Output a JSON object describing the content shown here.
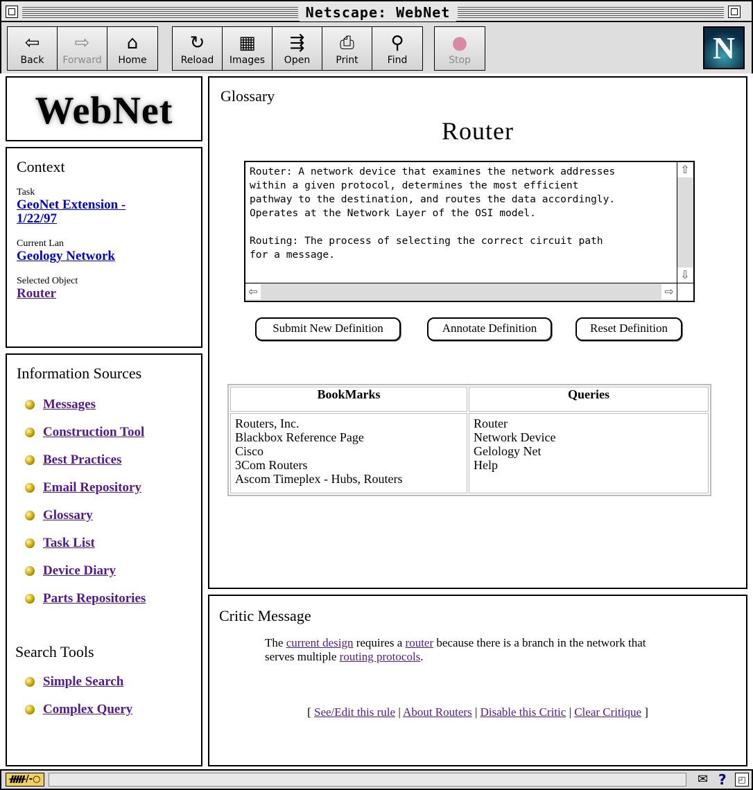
{
  "window": {
    "title": "Netscape: WebNet"
  },
  "toolbar": {
    "buttons": [
      {
        "label": "Back",
        "icon": "back-arrow-icon",
        "glyph": "⇦"
      },
      {
        "label": "Forward",
        "icon": "forward-arrow-icon",
        "glyph": "⇨"
      },
      {
        "label": "Home",
        "icon": "home-icon",
        "glyph": "⌂"
      },
      {
        "label": "Reload",
        "icon": "reload-icon",
        "glyph": "↻"
      },
      {
        "label": "Images",
        "icon": "images-icon",
        "glyph": "▦"
      },
      {
        "label": "Open",
        "icon": "open-icon",
        "glyph": "⇶"
      },
      {
        "label": "Print",
        "icon": "print-icon",
        "glyph": "⎙"
      },
      {
        "label": "Find",
        "icon": "find-binoculars-icon",
        "glyph": "⚲"
      },
      {
        "label": "Stop",
        "icon": "stop-icon",
        "glyph": "●"
      }
    ],
    "logo_letter": "N"
  },
  "logo": {
    "text": "WebNet"
  },
  "context": {
    "heading": "Context",
    "task_label": "Task",
    "task_value": "GeoNet Extension - 1/22/97",
    "lan_label": "Current Lan",
    "lan_value": "Geology Network",
    "object_label": "Selected Object",
    "object_value": "Router"
  },
  "sources": {
    "heading": "Information Sources",
    "items": [
      "Messages",
      "Construction Tool",
      "Best Practices",
      "Email Repository",
      "Glossary",
      "Task List",
      "Device Diary",
      "Parts Repositories"
    ],
    "search_heading": "Search Tools",
    "search_items": [
      "Simple Search",
      "Complex Query"
    ]
  },
  "glossary": {
    "heading": "Glossary",
    "term": "Router",
    "definition": "Router: A network device that examines the network addresses\nwithin a given protocol, determines the most efficient\npathway to the destination, and routes the data accordingly.\nOperates at the Network Layer of the OSI model.\n\nRouting: The process of selecting the correct circuit path\nfor a message.",
    "buttons": {
      "submit": "Submit New Definition",
      "annotate": "Annotate Definition",
      "reset": "Reset Definition"
    }
  },
  "tables": {
    "bookmarks_header": "BookMarks",
    "queries_header": "Queries",
    "bookmarks": [
      "Routers, Inc.",
      "Blackbox Reference Page",
      "Cisco",
      "3Com Routers",
      "Ascom Timeplex - Hubs, Routers"
    ],
    "queries": [
      "Router",
      "Network Device",
      "Gelology Net",
      "Help"
    ]
  },
  "critic": {
    "heading": "Critic Message",
    "text_1": "The ",
    "link_1": "current design",
    "text_2": " requires a ",
    "link_2": "router",
    "text_3": " because there is a branch in the network that serves multiple ",
    "link_3": "routing protocols",
    "text_4": ".",
    "bracket_open": "[ ",
    "bracket_close": " ]",
    "sep": " | ",
    "actions": [
      "See/Edit this rule",
      "About Routers",
      "Disable this Critic",
      "Clear Critique"
    ]
  },
  "statusbar": {
    "security_text": "ᚏ/-○",
    "mail_glyph": "✉",
    "help_glyph": "?",
    "grow_glyph": "◰"
  }
}
